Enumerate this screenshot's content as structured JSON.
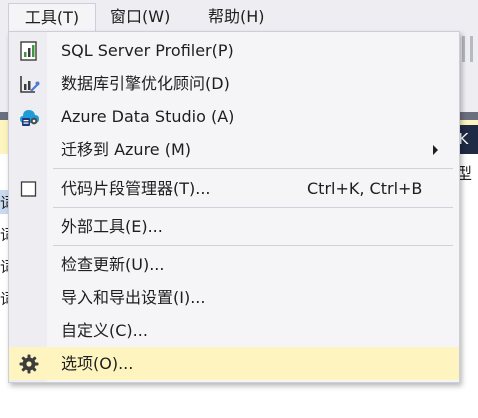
{
  "menubar": {
    "items": [
      {
        "label": "工具(T)",
        "active": true
      },
      {
        "label": "窗口(W)",
        "active": false
      },
      {
        "label": "帮助(H)",
        "active": false
      }
    ]
  },
  "background": {
    "grid_header_text": "CK",
    "column_type_label": "型",
    "left_edge_glyph": "词"
  },
  "tools_menu": {
    "items": [
      {
        "label": "SQL Server Profiler(P)",
        "icon": "sql-profiler-icon"
      },
      {
        "label": "数据库引擎优化顾问(D)",
        "icon": "tuning-advisor-icon"
      },
      {
        "label": "Azure Data Studio (A)",
        "icon": "azure-data-studio-icon"
      },
      {
        "label": "迁移到 Azure (M)",
        "has_submenu": true
      },
      {
        "label": "代码片段管理器(T)...",
        "icon": "code-snippets-icon",
        "shortcut": "Ctrl+K, Ctrl+B"
      },
      {
        "label": "外部工具(E)..."
      },
      {
        "label": "检查更新(U)..."
      },
      {
        "label": "导入和导出设置(I)..."
      },
      {
        "label": "自定义(C)..."
      },
      {
        "label": "选项(O)...",
        "icon": "gear-icon",
        "highlighted": true
      }
    ]
  },
  "colors": {
    "menu_background": "#f5f5f7",
    "icon_column": "#eeeef2",
    "highlight": "#fdf4bf",
    "border": "#ccceda"
  }
}
